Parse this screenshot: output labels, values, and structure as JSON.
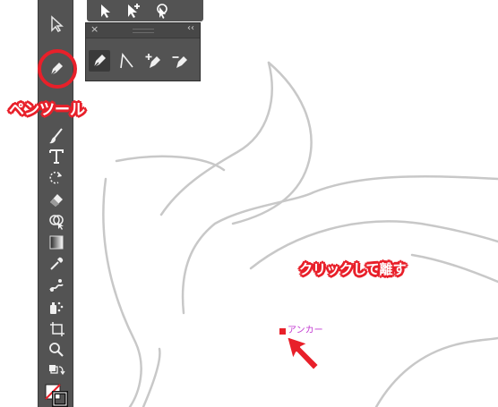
{
  "colors": {
    "toolbar_bg": "#535353",
    "annotation_red": "#e8202a",
    "anchor_label": "#c23ad1",
    "guide_stroke": "#c8c8c8"
  },
  "toolbar": {
    "tools": [
      {
        "name": "direct-selection-tool",
        "icon": "direct-selection-arrow-icon"
      },
      {
        "name": "pen-tool",
        "icon": "pen-nib-icon",
        "selected": true
      },
      {
        "name": "paintbrush-tool",
        "icon": "paintbrush-icon"
      },
      {
        "name": "type-tool",
        "icon": "type-t-icon",
        "glyph": "T"
      },
      {
        "name": "rotate-tool",
        "icon": "rotate-icon"
      },
      {
        "name": "eraser-tool",
        "icon": "eraser-icon"
      },
      {
        "name": "shape-builder-tool",
        "icon": "shape-builder-icon"
      },
      {
        "name": "gradient-tool",
        "icon": "gradient-icon"
      },
      {
        "name": "eyedropper-tool",
        "icon": "eyedropper-icon"
      },
      {
        "name": "puppet-warp-tool",
        "icon": "puppet-warp-icon"
      },
      {
        "name": "symbol-sprayer-tool",
        "icon": "symbol-sprayer-icon"
      },
      {
        "name": "artboard-tool",
        "icon": "artboard-icon"
      },
      {
        "name": "zoom-tool",
        "icon": "magnifier-icon"
      },
      {
        "name": "swap-fill-stroke",
        "icon": "swap-arrows-icon"
      },
      {
        "name": "fill-stroke-swatches",
        "icon": "fill-stroke-swatch-icon"
      }
    ]
  },
  "pen_panel": {
    "tools": [
      {
        "name": "pen-tool",
        "icon": "pen-nib-icon"
      },
      {
        "name": "anchor-point-tool",
        "icon": "anchor-convert-icon"
      },
      {
        "name": "add-anchor-point-tool",
        "icon": "pen-plus-icon"
      },
      {
        "name": "delete-anchor-point-tool",
        "icon": "pen-minus-icon"
      }
    ]
  },
  "annotations": {
    "pen_tool_label": "ペンツール",
    "click_label": "クリックして離す",
    "anchor_label": "アンカー"
  }
}
